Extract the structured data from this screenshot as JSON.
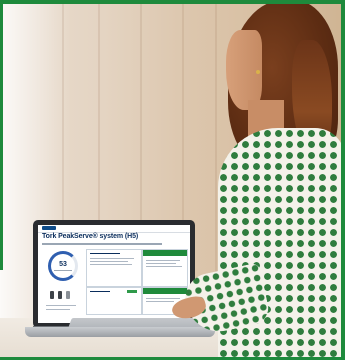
{
  "laptop_screen": {
    "title": "Tork PeakServe® system (H5)",
    "gauge_value": "53"
  },
  "colors": {
    "frame_green": "#1e8a3c",
    "shirt_dot_green": "#2f7d3e",
    "screen_title_navy": "#0a2d5c",
    "hair_auburn": "#6b3418"
  }
}
